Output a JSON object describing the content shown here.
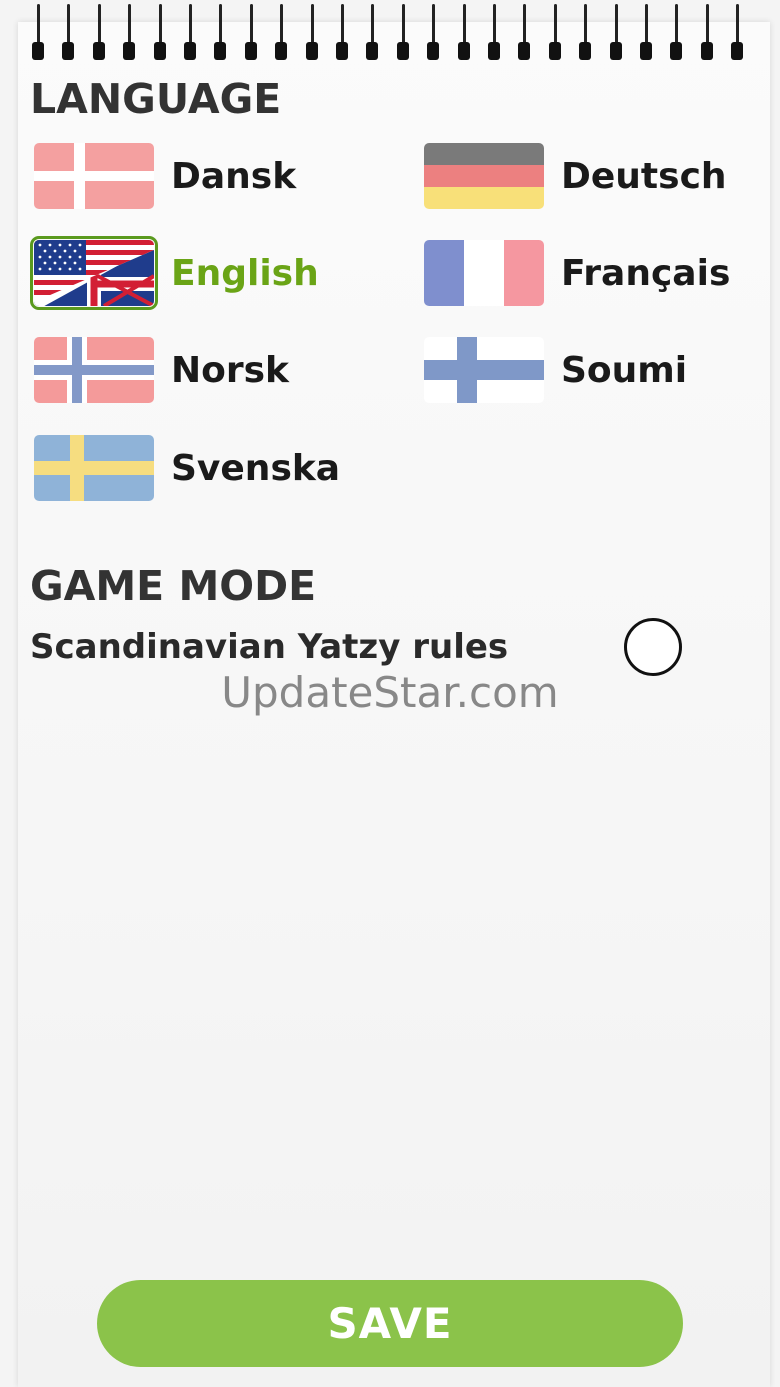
{
  "sections": {
    "language_title": "LANGUAGE",
    "game_mode_title": "GAME MODE"
  },
  "languages": [
    {
      "label": "Dansk",
      "flag": "denmark-flag",
      "selected": false
    },
    {
      "label": "Deutsch",
      "flag": "germany-flag",
      "selected": false
    },
    {
      "label": "English",
      "flag": "uk-us-flag",
      "selected": true
    },
    {
      "label": "Français",
      "flag": "france-flag",
      "selected": false
    },
    {
      "label": "Norsk",
      "flag": "norway-flag",
      "selected": false
    },
    {
      "label": "Soumi",
      "flag": "finland-flag",
      "selected": false
    },
    {
      "label": "Svenska",
      "flag": "sweden-flag",
      "selected": false
    }
  ],
  "game_mode": {
    "option_label": "Scandinavian Yatzy rules",
    "option_checked": false
  },
  "watermark": "UpdateStar.com",
  "save_label": "SAVE",
  "colors": {
    "accent_green": "#8bc34a",
    "selected_text": "#6aa416"
  }
}
